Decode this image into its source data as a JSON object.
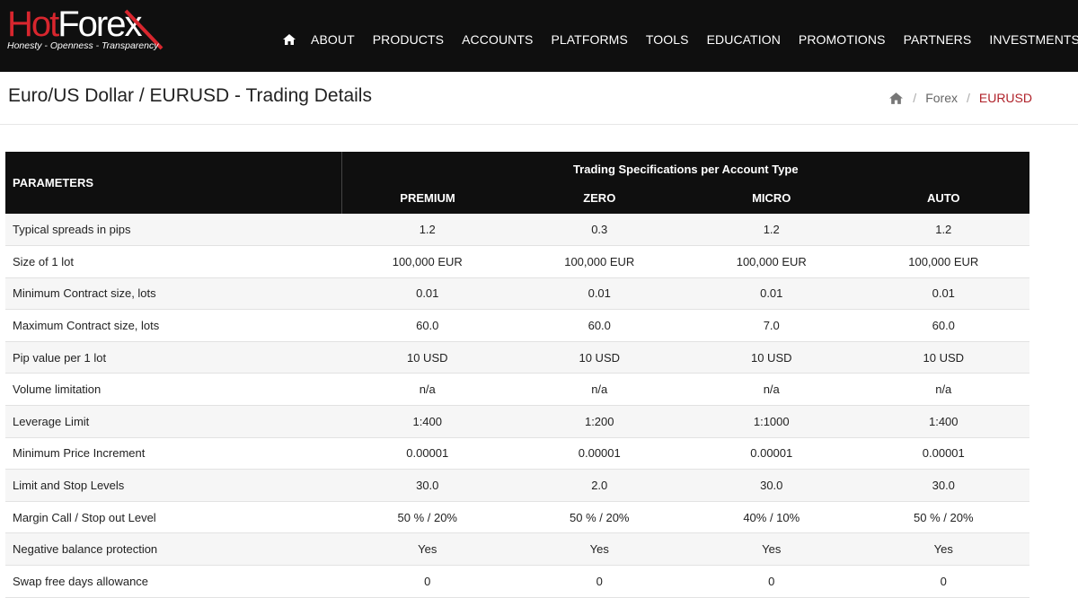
{
  "brand": {
    "logo_part1": "Hot",
    "logo_part2": "Forex",
    "tagline": "Honesty - Openness - Transparency",
    "accent_color": "#d8262e"
  },
  "nav": {
    "home_icon": "home-icon",
    "items": [
      "ABOUT",
      "PRODUCTS",
      "ACCOUNTS",
      "PLATFORMS",
      "TOOLS",
      "EDUCATION",
      "PROMOTIONS",
      "PARTNERS",
      "INVESTMENTS"
    ]
  },
  "page": {
    "title": "Euro/US Dollar / EURUSD - Trading Details"
  },
  "breadcrumb": {
    "home_icon": "home-icon",
    "items": [
      "Forex",
      "EURUSD"
    ]
  },
  "table": {
    "param_header": "PARAMETERS",
    "group_header": "Trading Specifications per Account Type",
    "accounts": [
      "PREMIUM",
      "ZERO",
      "MICRO",
      "AUTO"
    ],
    "rows": [
      {
        "param": "Typical spreads in pips",
        "values": [
          "1.2",
          "0.3",
          "1.2",
          "1.2"
        ]
      },
      {
        "param": "Size of 1 lot",
        "values": [
          "100,000 EUR",
          "100,000 EUR",
          "100,000 EUR",
          "100,000 EUR"
        ]
      },
      {
        "param": "Minimum Contract size, lots",
        "values": [
          "0.01",
          "0.01",
          "0.01",
          "0.01"
        ]
      },
      {
        "param": "Maximum Contract size, lots",
        "values": [
          "60.0",
          "60.0",
          "7.0",
          "60.0"
        ]
      },
      {
        "param": "Pip value per 1 lot",
        "values": [
          "10 USD",
          "10 USD",
          "10 USD",
          "10 USD"
        ]
      },
      {
        "param": "Volume limitation",
        "values": [
          "n/a",
          "n/a",
          "n/a",
          "n/a"
        ]
      },
      {
        "param": "Leverage Limit",
        "values": [
          "1:400",
          "1:200",
          "1:1000",
          "1:400"
        ]
      },
      {
        "param": "Minimum Price Increment",
        "values": [
          "0.00001",
          "0.00001",
          "0.00001",
          "0.00001"
        ]
      },
      {
        "param": "Limit and Stop Levels",
        "values": [
          "30.0",
          "2.0",
          "30.0",
          "30.0"
        ]
      },
      {
        "param": "Margin Call / Stop out Level",
        "values": [
          "50 % / 20%",
          "50 % / 20%",
          "40% / 10%",
          "50 % / 20%"
        ]
      },
      {
        "param": "Negative balance protection",
        "values": [
          "Yes",
          "Yes",
          "Yes",
          "Yes"
        ]
      },
      {
        "param": "Swap free days allowance",
        "values": [
          "0",
          "0",
          "0",
          "0"
        ]
      }
    ]
  }
}
